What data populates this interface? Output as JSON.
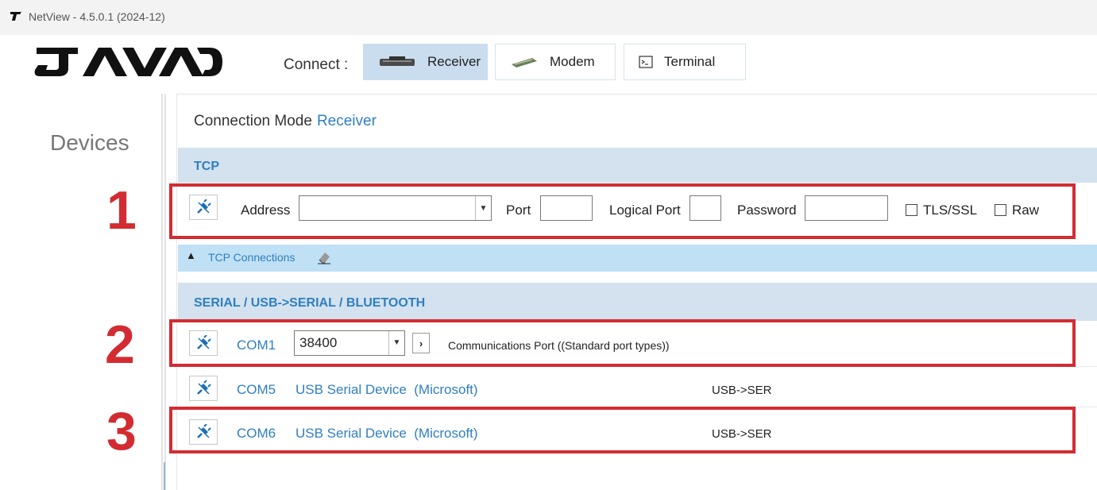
{
  "window": {
    "title": "NetView - 4.5.0.1 (2024-12)"
  },
  "header": {
    "connect_label": "Connect :",
    "modes": [
      {
        "label": "Receiver",
        "icon": "receiver-icon",
        "active": true
      },
      {
        "label": "Modem",
        "icon": "modem-icon",
        "active": false
      },
      {
        "label": "Terminal",
        "icon": "terminal-icon",
        "active": false
      }
    ]
  },
  "sidebar": {
    "title": "Devices"
  },
  "connection_mode": {
    "label": "Connection Mode",
    "value": "Receiver"
  },
  "tcp": {
    "header": "TCP",
    "address_label": "Address",
    "address_value": "",
    "port_label": "Port",
    "port_value": "",
    "logical_port_label": "Logical Port",
    "logical_port_value": "",
    "password_label": "Password",
    "password_value": "",
    "tls_label": "TLS/SSL",
    "tls_checked": false,
    "raw_label": "Raw",
    "raw_checked": false
  },
  "tcp_connections": {
    "label": "TCP Connections"
  },
  "serial": {
    "header": "SERIAL / USB->SERIAL / BLUETOOTH",
    "ports": [
      {
        "name": "COM1",
        "baud": "38400",
        "description": "Communications Port  ((Standard port types))",
        "type": ""
      },
      {
        "name": "COM5",
        "description": "USB Serial Device  (Microsoft)",
        "type": "USB->SER"
      },
      {
        "name": "COM6",
        "description": "USB Serial Device  (Microsoft)",
        "type": "USB->SER"
      }
    ]
  },
  "annotations": [
    "1",
    "2",
    "3"
  ],
  "colors": {
    "accent": "#2f7fc1",
    "highlight": "#d22c32",
    "section_bg": "#d3e2ee"
  }
}
